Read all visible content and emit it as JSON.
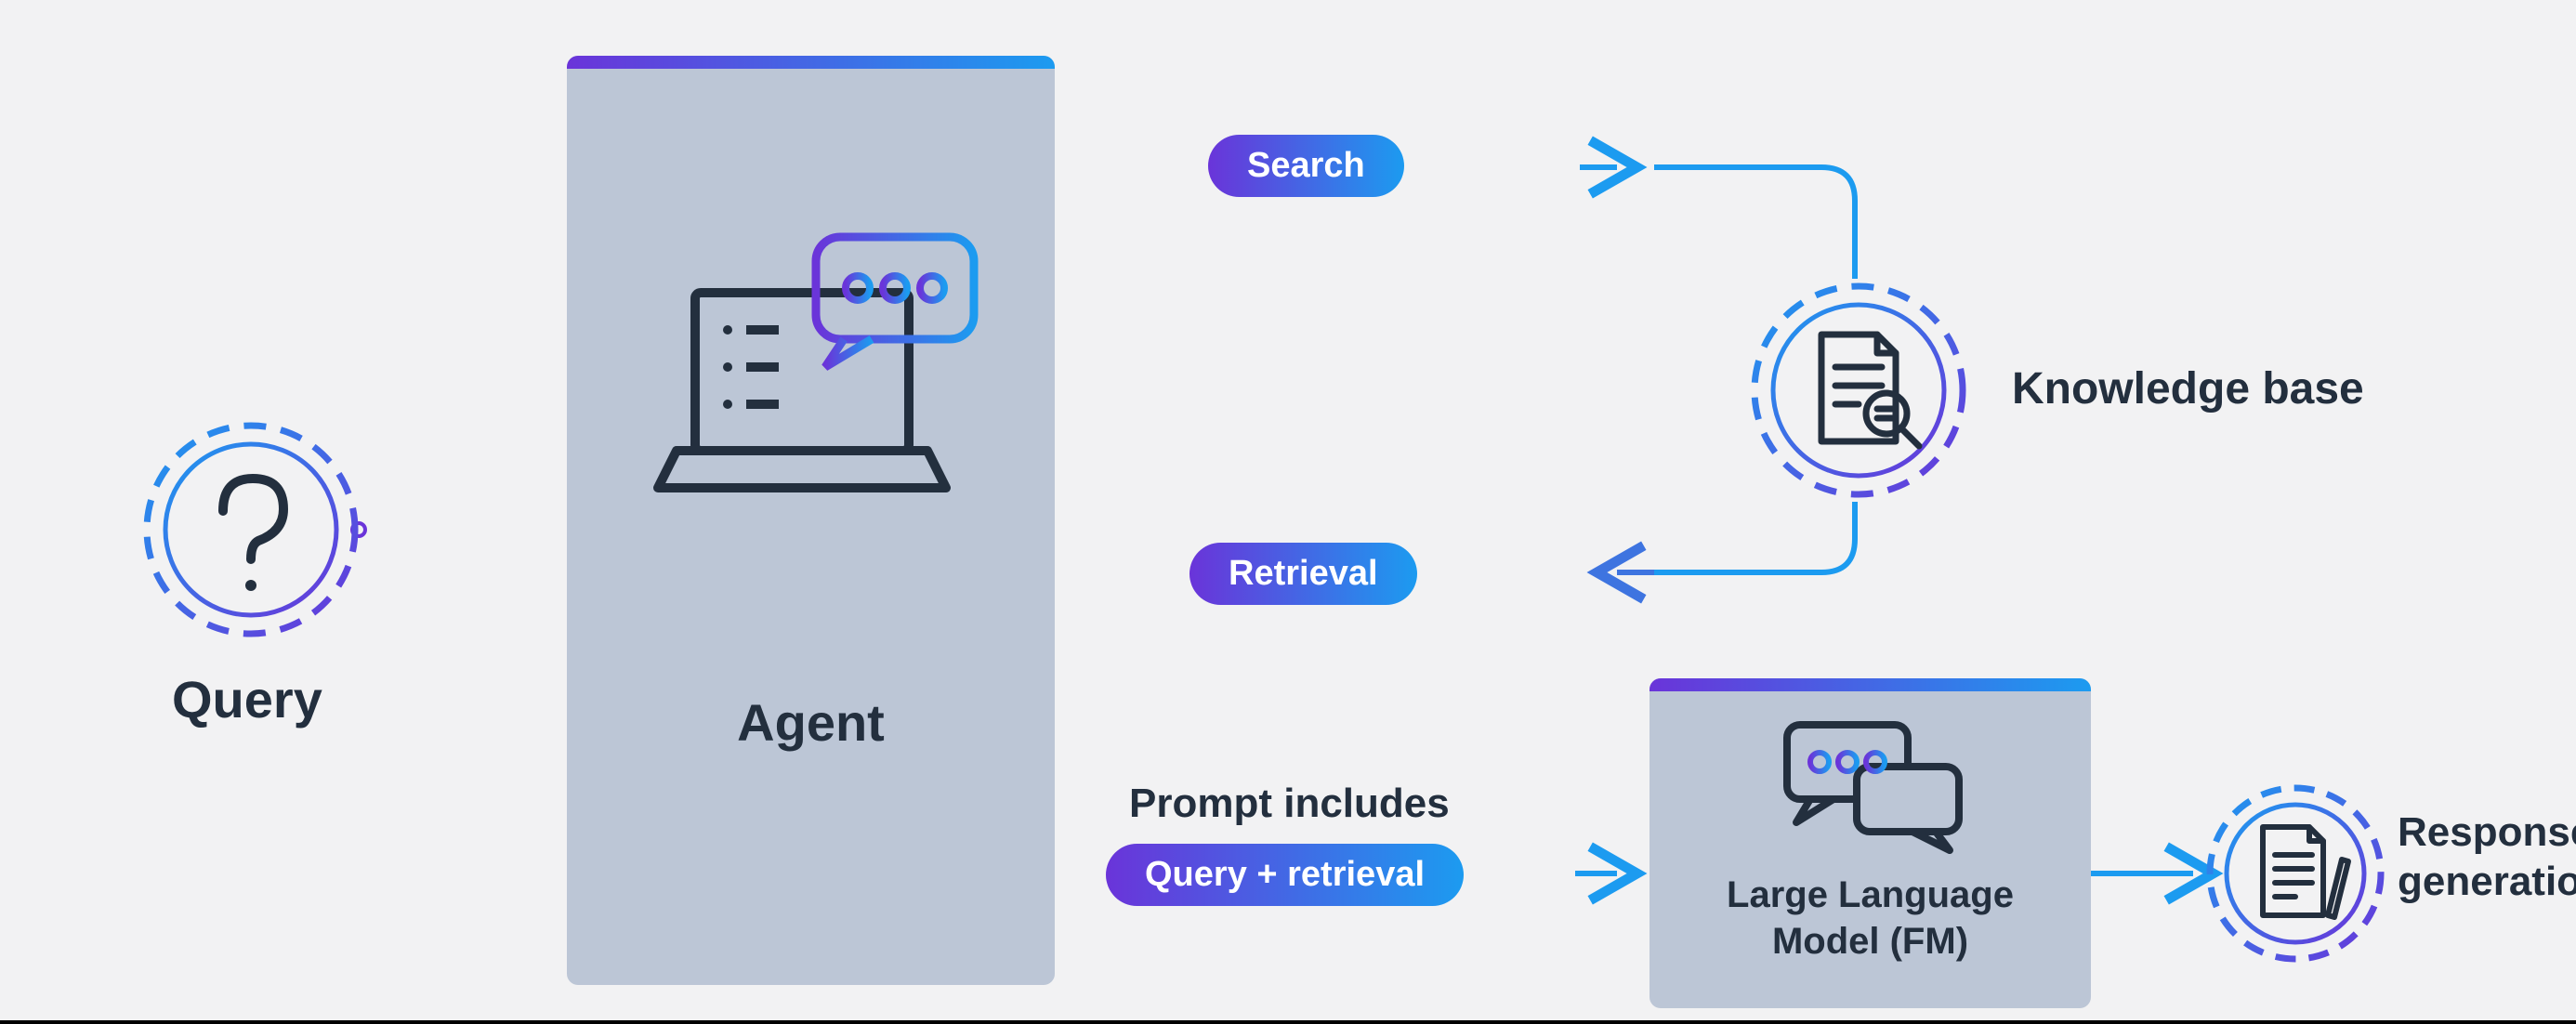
{
  "nodes": {
    "query": {
      "label": "Query"
    },
    "agent": {
      "label": "Agent"
    },
    "knowledge_base": {
      "label": "Knowledge base"
    },
    "llm": {
      "label": "Large Language\nModel (FM)"
    },
    "response": {
      "label": "Response\ngeneration"
    }
  },
  "edges": {
    "search": {
      "label": "Search"
    },
    "retrieval": {
      "label": "Retrieval"
    },
    "prompt_caption": "Prompt includes",
    "prompt_pill": "Query + retrieval"
  }
}
